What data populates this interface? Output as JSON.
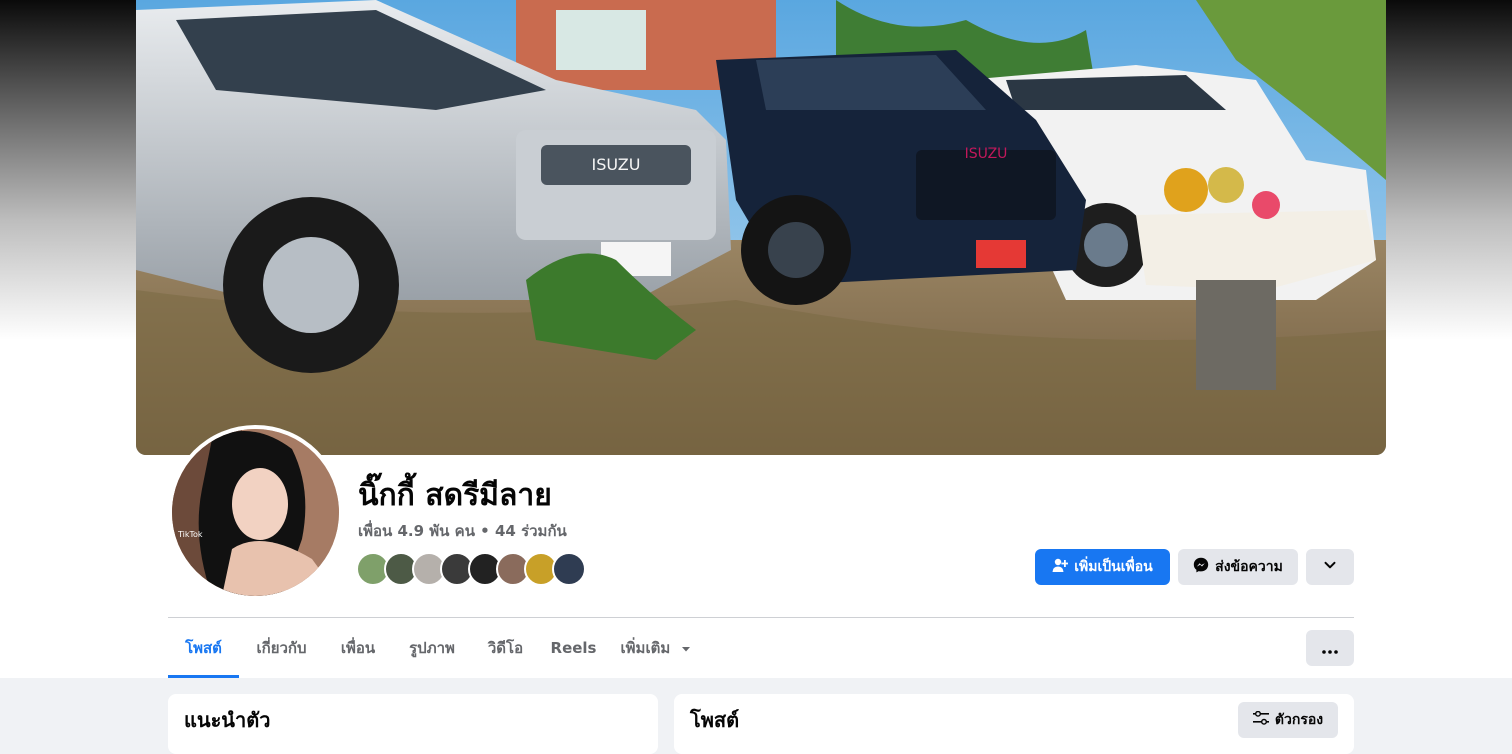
{
  "profile": {
    "name": "นิ๊กกี้ สดรีมีลาย",
    "friends_summary": "เพื่อน 4.9 พัน คน • 44 ร่วมกัน",
    "avatar_overlay_text": "TikTok",
    "cover_brand_text": "ISUZU"
  },
  "actions": {
    "add_friend_label": "เพิ่มเป็นเพื่อน",
    "message_label": "ส่งข้อความ",
    "add_friend_icon": "person-add-icon",
    "message_icon": "messenger-icon",
    "more_icon": "chevron-down-icon"
  },
  "tabs": [
    {
      "label": "โพสต์",
      "active": true
    },
    {
      "label": "เกี่ยวกับ"
    },
    {
      "label": "เพื่อน"
    },
    {
      "label": "รูปภาพ"
    },
    {
      "label": "วิดีโอ"
    },
    {
      "label": "Reels"
    },
    {
      "label": "เพิ่มเติม"
    }
  ],
  "intro": {
    "title": "แนะนำตัว"
  },
  "posts": {
    "title": "โพสต์",
    "filter_label": "ตัวกรอง",
    "filter_icon": "sliders-icon"
  },
  "colors": {
    "accent": "#1877f2",
    "secondary_button": "#e4e6eb",
    "muted_text": "#65676b",
    "page_background": "#f0f2f5"
  }
}
